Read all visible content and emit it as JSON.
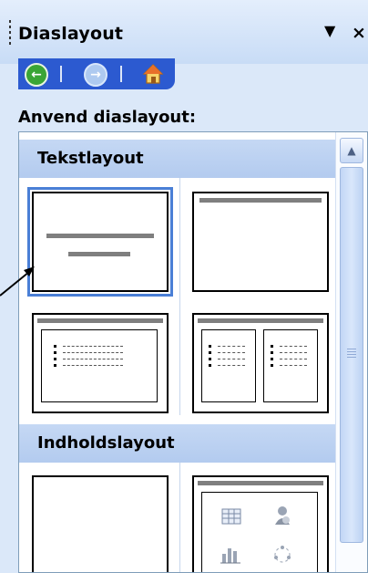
{
  "pane": {
    "title": "Diaslayout",
    "menu_icon": "dropdown-triangle-icon",
    "close_symbol": "×"
  },
  "nav": {
    "back_icon": "back-arrow-icon",
    "forward_icon": "forward-arrow-icon",
    "home_icon": "home-icon"
  },
  "section_label": "Anvend diaslayout:",
  "groups": [
    {
      "header": "Tekstlayout",
      "layouts": [
        "title-slide",
        "title-only",
        "title-and-text",
        "title-and-two-column-text"
      ]
    },
    {
      "header": "Indholdslayout",
      "layouts": [
        "blank",
        "title-and-content"
      ]
    }
  ],
  "content_icons": [
    "table-icon",
    "clip-art-icon",
    "chart-icon",
    "diagram-icon"
  ],
  "colors": {
    "pane_bg": "#dbe8f9",
    "nav_bg": "#2c5ad0",
    "group_header_bg": "#b9cff1",
    "selection": "#4a7fd6"
  }
}
